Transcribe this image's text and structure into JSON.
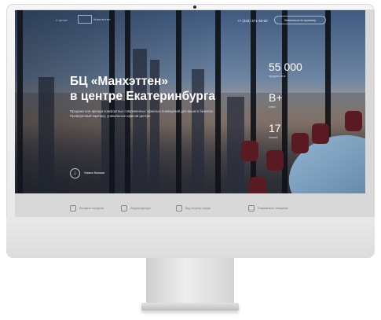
{
  "header": {
    "logo_text": "Манхэттен",
    "link_1": "О центре",
    "phone": "+7 (343) 371-48-00",
    "cta_label": "Записаться на просмотр"
  },
  "hero": {
    "title_line1": "БЦ «Манхэттен»",
    "title_line2": "в центре Екатеринбурга",
    "lead": "Продажа или аренда комфортных современных офисных помещений для вашего бизнеса. Проверенный партнер, уникальных офисов центре.",
    "more_label": "Узнать больше"
  },
  "stats": [
    {
      "value": "55 000",
      "label": "продано кв.м"
    },
    {
      "value": "B+",
      "label": "класс"
    },
    {
      "value": "17",
      "label": "этажей"
    }
  ],
  "features": [
    {
      "text": "Выгодное соседство",
      "icon": "building-icon"
    },
    {
      "text": "Инфраструктура",
      "icon": "car-icon"
    },
    {
      "text": "Вид на центр города",
      "icon": "window-icon"
    },
    {
      "text": "Современное оснащение",
      "icon": "gear-icon"
    }
  ],
  "colors": {
    "accent": "#ffffff",
    "screen_bg": "#30405a"
  }
}
